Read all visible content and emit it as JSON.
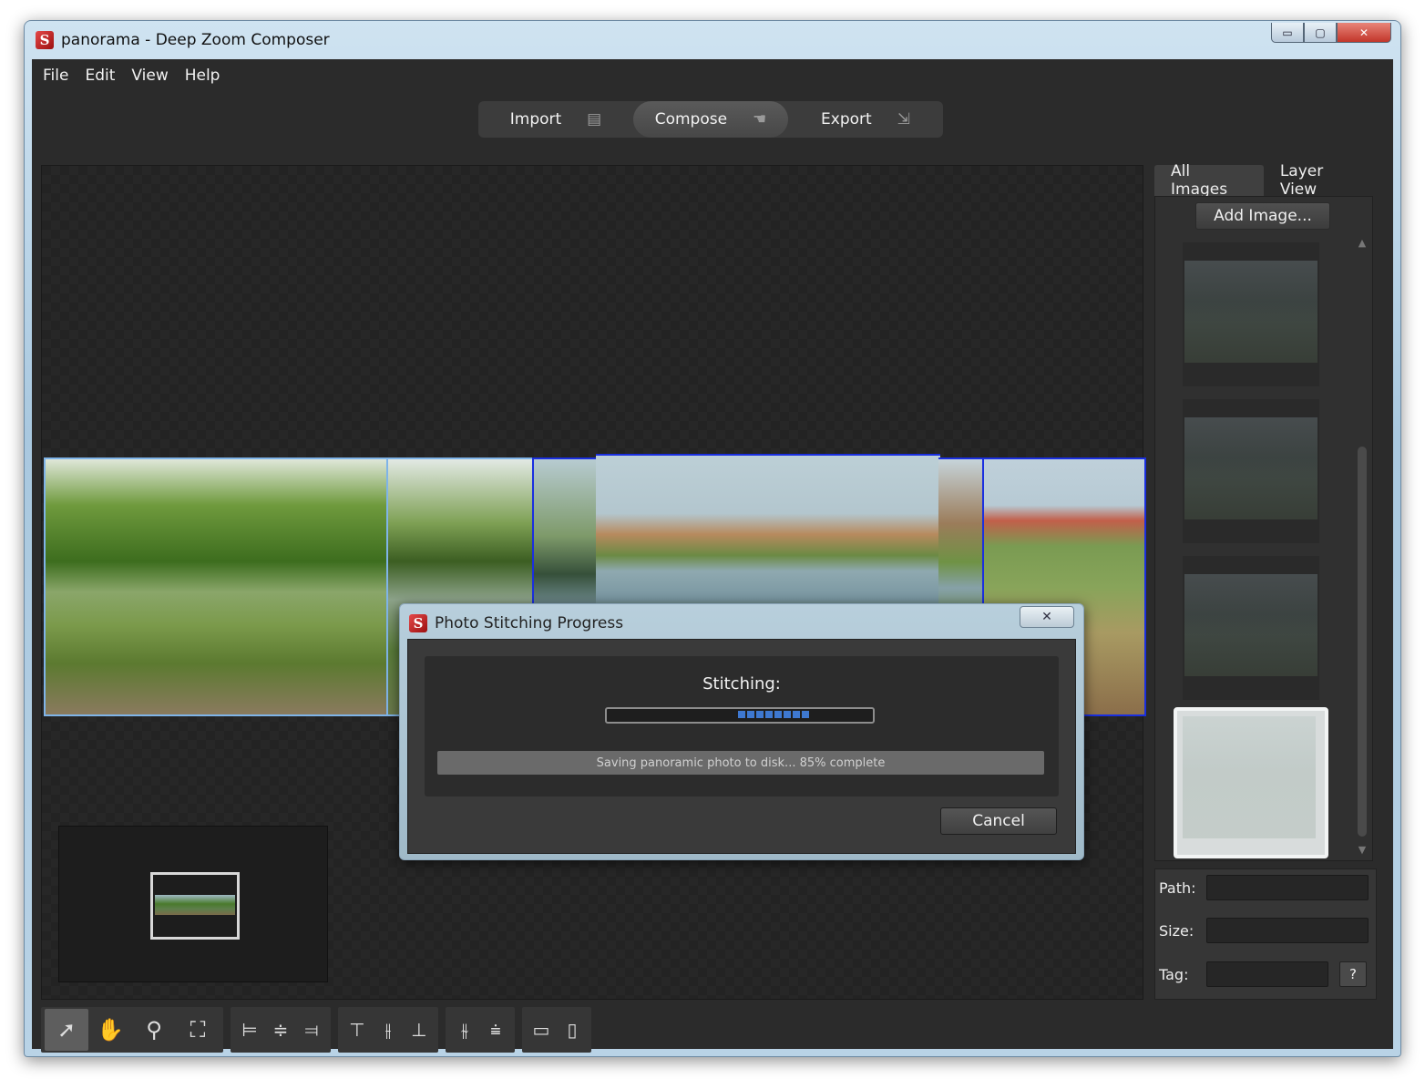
{
  "window": {
    "title": "panorama - Deep Zoom Composer",
    "controls": {
      "minimize": "▭",
      "restore": "▢",
      "close": "✕"
    }
  },
  "menu": [
    "File",
    "Edit",
    "View",
    "Help"
  ],
  "modes": [
    {
      "label": "Import",
      "icon": "import-icon",
      "active": false
    },
    {
      "label": "Compose",
      "icon": "compose-hand-icon",
      "active": true
    },
    {
      "label": "Export",
      "icon": "export-icon",
      "active": false
    }
  ],
  "right_panel": {
    "tabs": [
      "All Images",
      "Layer View"
    ],
    "active_tab": "All Images",
    "add_image_label": "Add Image...",
    "thumbnails": 4,
    "properties": {
      "path_label": "Path:",
      "size_label": "Size:",
      "tag_label": "Tag:",
      "path_value": "",
      "size_value": "",
      "tag_value": "",
      "help_label": "?"
    }
  },
  "dialog": {
    "title": "Photo Stitching Progress",
    "heading": "Stitching:",
    "status": "Saving panoramic photo to disk... 85% complete",
    "progress_percent": 85,
    "cancel_label": "Cancel",
    "close_label": "✕"
  },
  "toolbar": {
    "tools": [
      "select-arrow-icon",
      "pan-hand-icon",
      "zoom-icon",
      "zoom-fit-icon"
    ],
    "align": [
      "align-left-icon",
      "align-center-icon",
      "align-right-icon"
    ],
    "valign": [
      "align-top-icon",
      "align-middle-icon",
      "align-bottom-icon"
    ],
    "distribute": [
      "distribute-horizontal-icon",
      "distribute-vertical-icon"
    ],
    "size": [
      "same-width-icon",
      "same-height-icon"
    ]
  },
  "colors": {
    "background": "#2b2b2b",
    "selection": "#1a2fe0",
    "progress": "#3e78d0"
  }
}
